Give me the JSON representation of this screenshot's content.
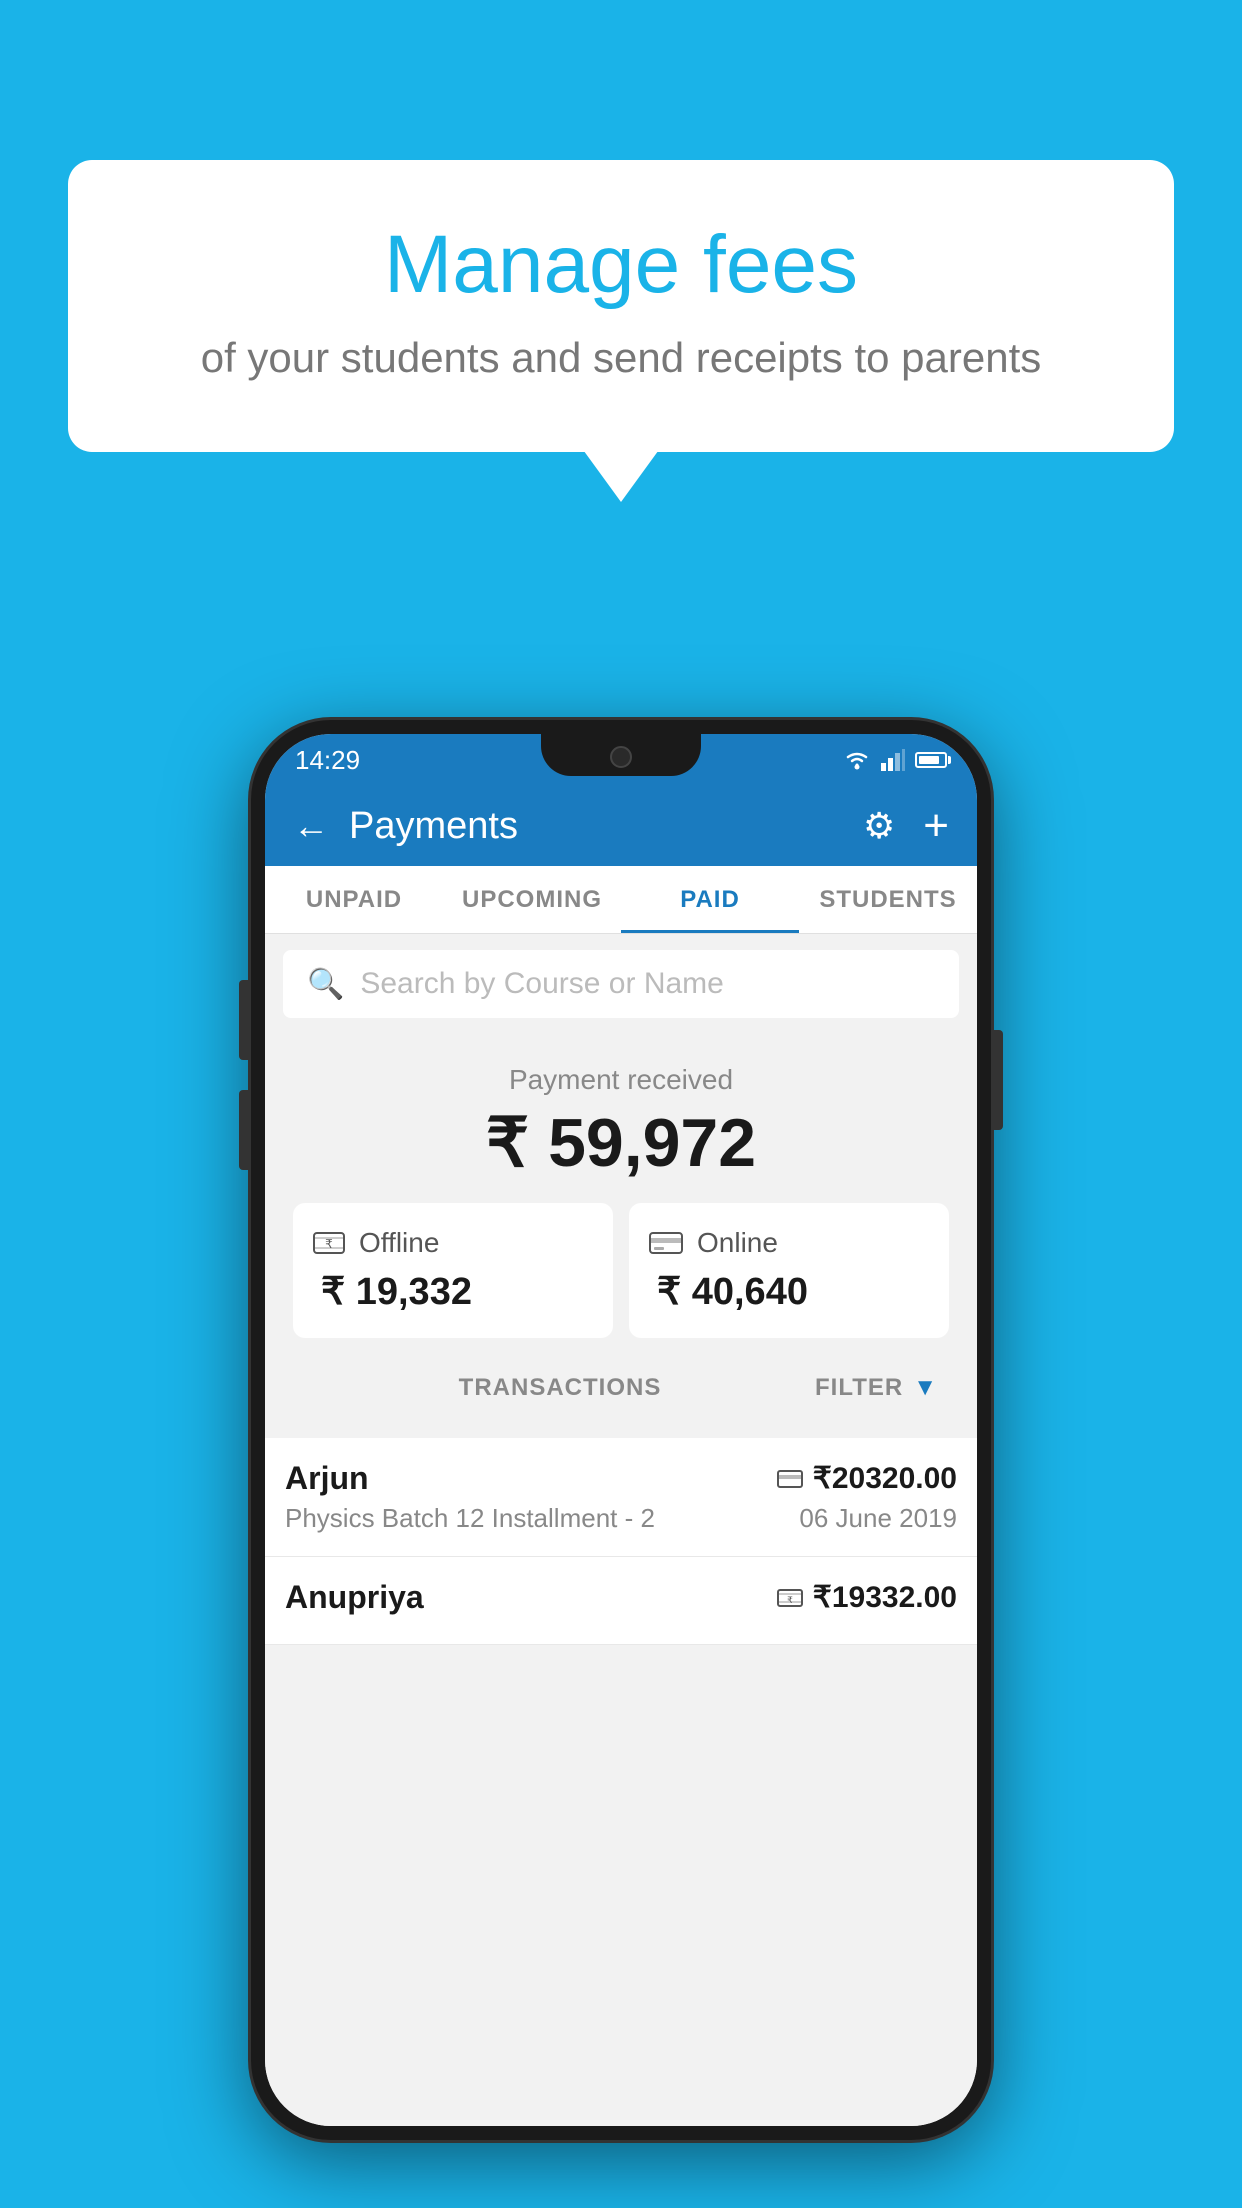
{
  "background_color": "#1ab3e8",
  "bubble": {
    "title": "Manage fees",
    "subtitle": "of your students and send receipts to parents"
  },
  "status_bar": {
    "time": "14:29"
  },
  "app_bar": {
    "title": "Payments",
    "back_label": "←",
    "settings_label": "⚙",
    "add_label": "+"
  },
  "tabs": [
    {
      "label": "UNPAID",
      "active": false
    },
    {
      "label": "UPCOMING",
      "active": false
    },
    {
      "label": "PAID",
      "active": true
    },
    {
      "label": "STUDENTS",
      "active": false
    }
  ],
  "search": {
    "placeholder": "Search by Course or Name"
  },
  "payment_summary": {
    "label": "Payment received",
    "amount": "₹ 59,972",
    "offline_label": "Offline",
    "offline_amount": "₹ 19,332",
    "online_label": "Online",
    "online_amount": "₹ 40,640"
  },
  "transactions_section": {
    "label": "TRANSACTIONS",
    "filter_label": "FILTER"
  },
  "transactions": [
    {
      "name": "Arjun",
      "course": "Physics Batch 12 Installment - 2",
      "amount": "₹20320.00",
      "date": "06 June 2019",
      "method": "card"
    },
    {
      "name": "Anupriya",
      "course": "",
      "amount": "₹19332.00",
      "date": "",
      "method": "cash"
    }
  ]
}
